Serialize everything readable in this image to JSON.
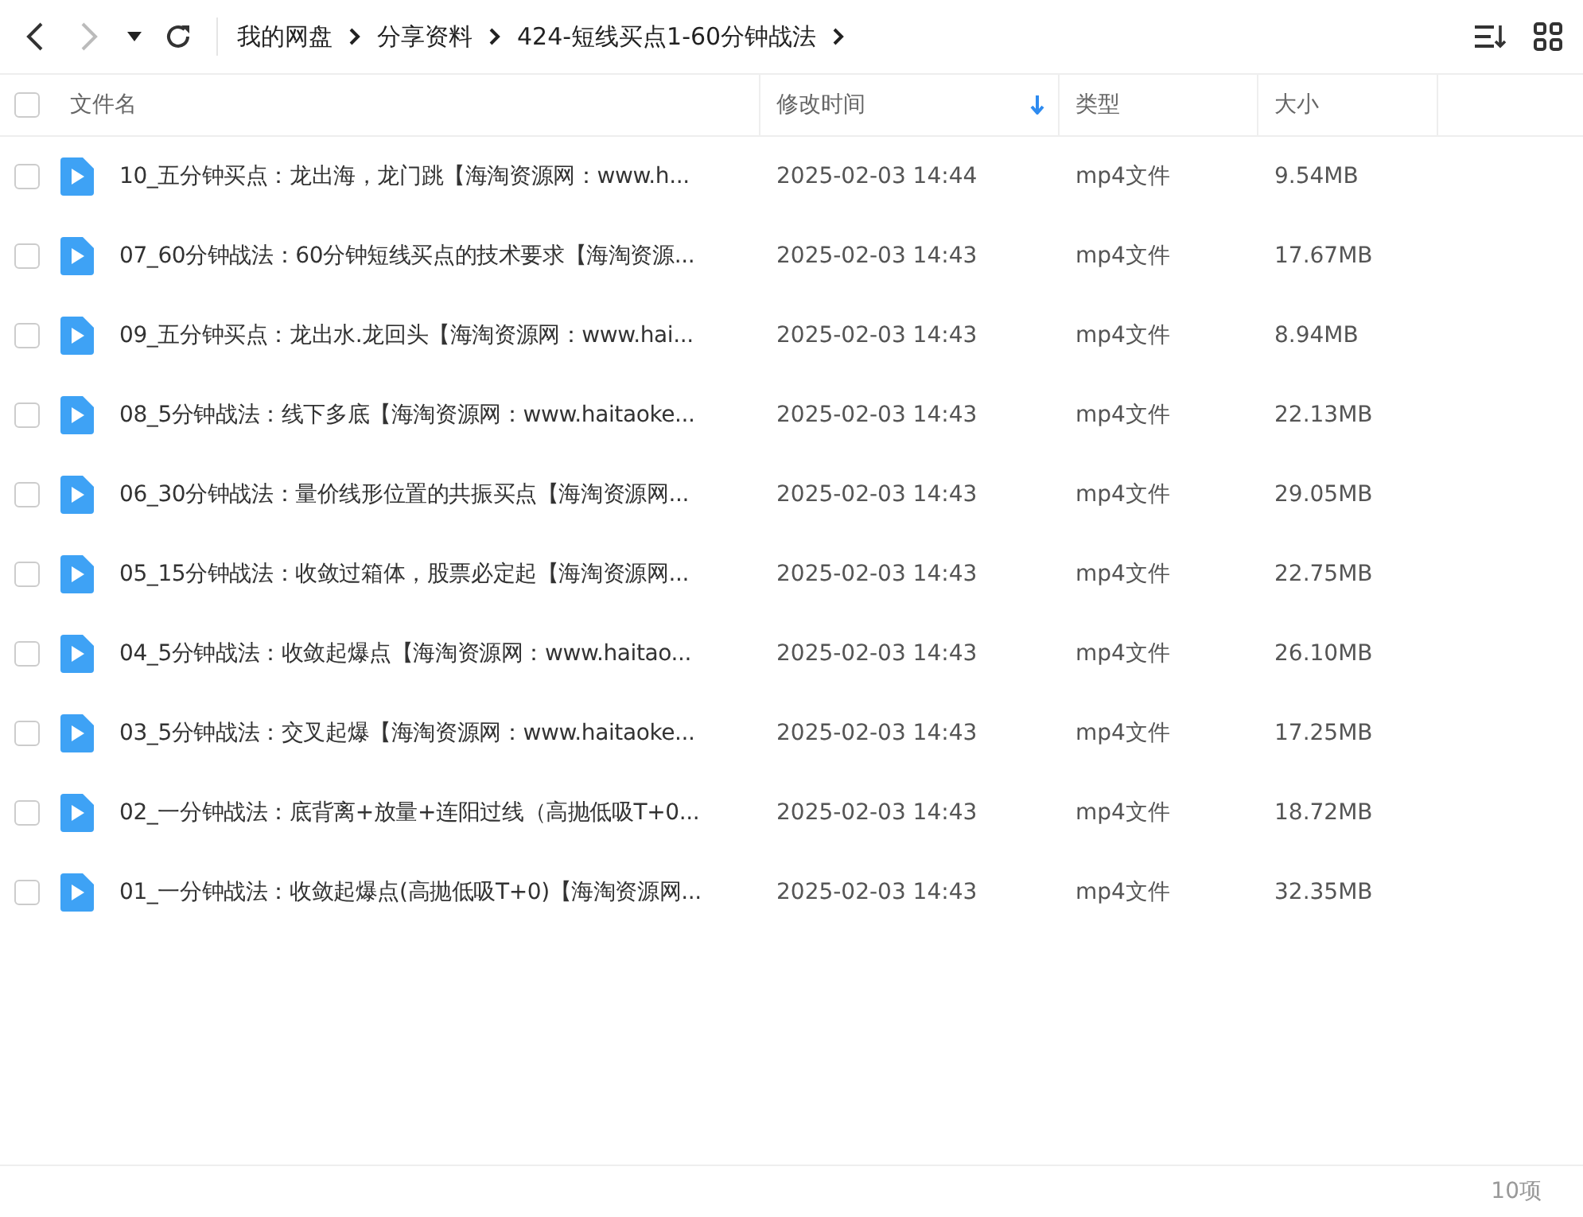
{
  "toolbar": {
    "back_disabled": false,
    "forward_disabled": true
  },
  "breadcrumb": [
    "我的网盘",
    "分享资料",
    "424-短线买点1-60分钟战法"
  ],
  "table": {
    "select_all_checked": false,
    "columns": [
      {
        "label": "文件名",
        "sorted": false
      },
      {
        "label": "修改时间",
        "sorted": true
      },
      {
        "label": "类型",
        "sorted": false
      },
      {
        "label": "大小",
        "sorted": false
      }
    ],
    "rows": [
      {
        "name": "10_五分钟买点：龙出海，龙门跳【海淘资源网：www.h...",
        "modified": "2025-02-03 14:44",
        "type": "mp4文件",
        "size": "9.54MB",
        "checked": false
      },
      {
        "name": "07_60分钟战法：60分钟短线买点的技术要求【海淘资源...",
        "modified": "2025-02-03 14:43",
        "type": "mp4文件",
        "size": "17.67MB",
        "checked": false
      },
      {
        "name": "09_五分钟买点：龙出水.龙回头【海淘资源网：www.hai...",
        "modified": "2025-02-03 14:43",
        "type": "mp4文件",
        "size": "8.94MB",
        "checked": false
      },
      {
        "name": "08_5分钟战法：线下多底【海淘资源网：www.haitaoke...",
        "modified": "2025-02-03 14:43",
        "type": "mp4文件",
        "size": "22.13MB",
        "checked": false
      },
      {
        "name": "06_30分钟战法：量价线形位置的共振买点【海淘资源网...",
        "modified": "2025-02-03 14:43",
        "type": "mp4文件",
        "size": "29.05MB",
        "checked": false
      },
      {
        "name": "05_15分钟战法：收敛过箱体，股票必定起【海淘资源网...",
        "modified": "2025-02-03 14:43",
        "type": "mp4文件",
        "size": "22.75MB",
        "checked": false
      },
      {
        "name": "04_5分钟战法：收敛起爆点【海淘资源网：www.haitao...",
        "modified": "2025-02-03 14:43",
        "type": "mp4文件",
        "size": "26.10MB",
        "checked": false
      },
      {
        "name": "03_5分钟战法：交叉起爆【海淘资源网：www.haitaoke...",
        "modified": "2025-02-03 14:43",
        "type": "mp4文件",
        "size": "17.25MB",
        "checked": false
      },
      {
        "name": "02_一分钟战法：底背离+放量+连阳过线（高抛低吸T+0...",
        "modified": "2025-02-03 14:43",
        "type": "mp4文件",
        "size": "18.72MB",
        "checked": false
      },
      {
        "name": "01_一分钟战法：收敛起爆点(高抛低吸T+0)【海淘资源网...",
        "modified": "2025-02-03 14:43",
        "type": "mp4文件",
        "size": "32.35MB",
        "checked": false
      }
    ]
  },
  "status_bar": {
    "count": "10项"
  }
}
